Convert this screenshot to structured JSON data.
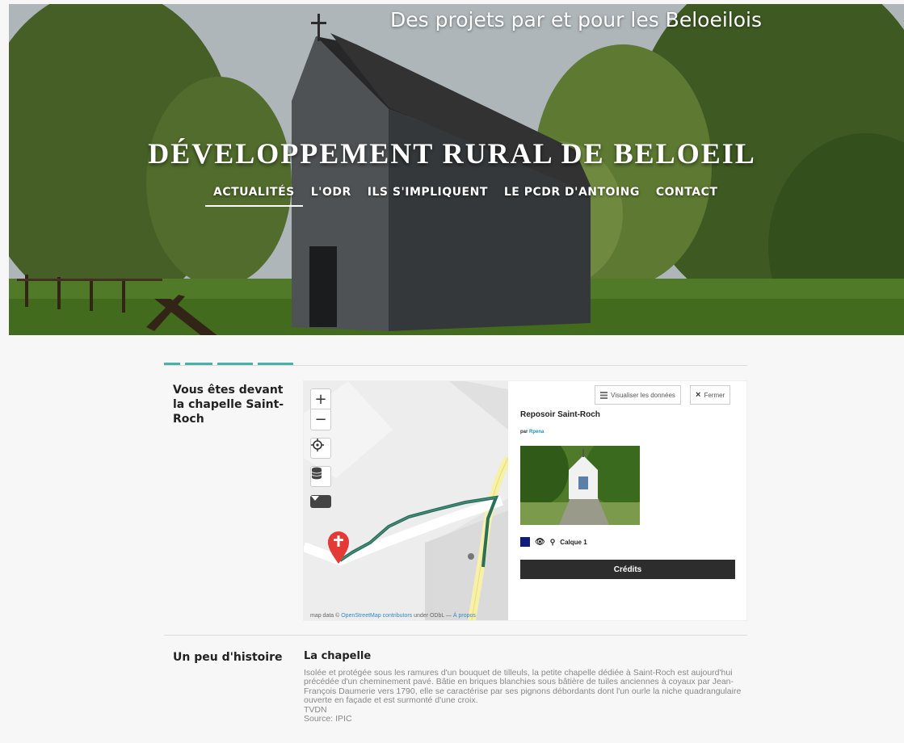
{
  "header": {
    "tagline": "Des projets par et pour les Beloeilois",
    "site_title": "DÉVELOPPEMENT RURAL DE BELOEIL",
    "nav": [
      {
        "label": "ACTUALITÉS",
        "active": true
      },
      {
        "label": "L'ODR",
        "active": false
      },
      {
        "label": "ILS S'IMPLIQUENT",
        "active": false
      },
      {
        "label": "LE PCDR D'ANTOING",
        "active": false
      },
      {
        "label": "CONTACT",
        "active": false
      }
    ]
  },
  "section1": {
    "label": "Vous êtes devant la chapelle Saint-Roch",
    "map": {
      "zoom_in": "+",
      "zoom_out": "−",
      "attribution_prefix": "map data © ",
      "attribution_link": "OpenStreetMap contributors",
      "attribution_mid": " under ODbL — ",
      "attribution_about": "À propos"
    },
    "panel": {
      "view_data": "Visualiser les données",
      "close": "Fermer",
      "title": "Reposoir Saint-Roch",
      "author_prefix": "par ",
      "author": "Rpena",
      "layer": "Calque 1",
      "credits": "Crédits"
    }
  },
  "section2": {
    "label": "Un peu d'histoire",
    "title": "La chapelle",
    "paragraph": "Isolée et protégée sous les ramures d'un bouquet de tilleuls, la petite chapelle dédiée à Saint-Roch est aujourd'hui précédée d'un cheminement pavé. Bâtie en briques blanchies sous bâtière de tuiles anciennes à coyaux par Jean-François Daumerie vers 1790, elle se caractérise par ses pignons débordants dont l'un ourle la niche quadrangulaire ouverte en façade et est surmonté d'une croix.",
    "line2": "TVDN",
    "line3": "Source: IPIC"
  },
  "colors": {
    "accent": "#1aa39a",
    "route": "#2a6e5c",
    "marker": "#e53935",
    "credits_bg": "#2d2d2d",
    "layer_swatch": "#101a7a"
  }
}
